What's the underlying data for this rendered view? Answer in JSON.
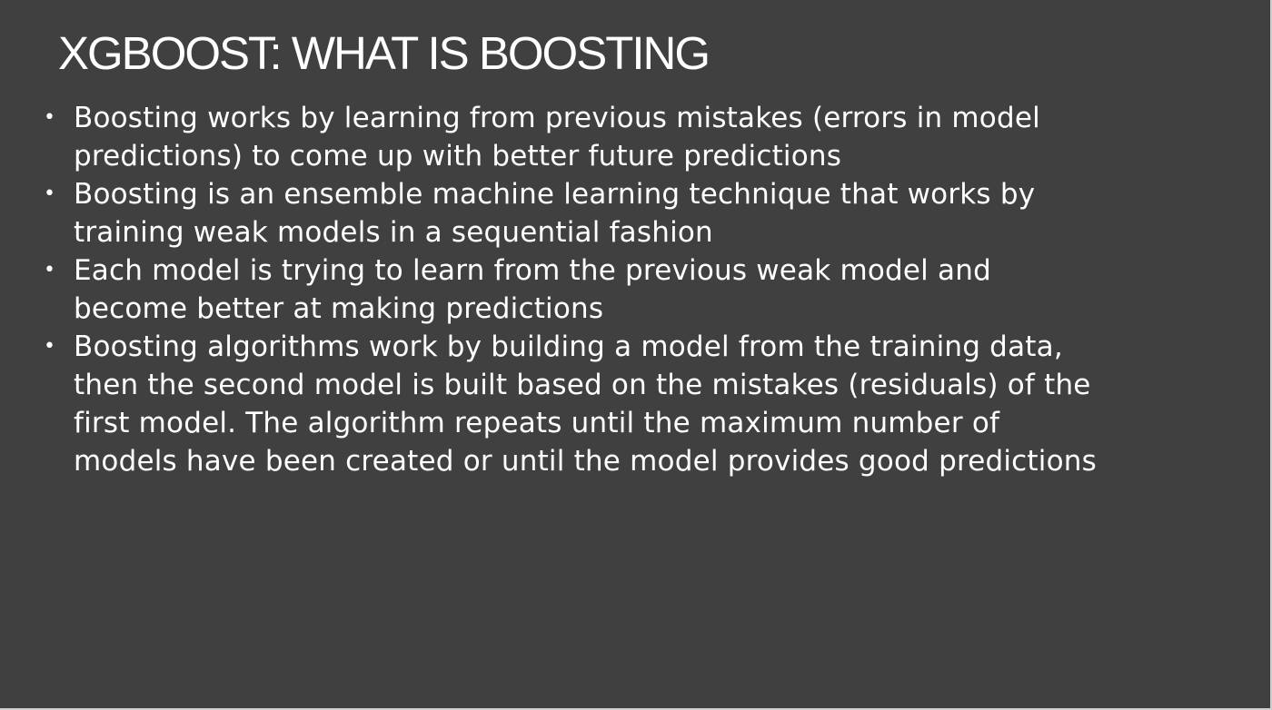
{
  "slide": {
    "title": "XGBOOST: WHAT IS BOOSTING",
    "bullet_glyph": "•",
    "bullets": [
      {
        "lines": [
          "Boosting works by learning from previous mistakes (errors in model",
          "predictions) to come up with better future predictions"
        ]
      },
      {
        "lines": [
          "Boosting is an ensemble machine learning technique that works by",
          "training weak models in a sequential fashion"
        ]
      },
      {
        "lines": [
          "Each model is trying to learn from the previous weak model and",
          "become better at making predictions"
        ]
      },
      {
        "lines": [
          "Boosting algorithms work by building a model from the training data,",
          "then the second model is built based on the mistakes (residuals) of the",
          "first model. The algorithm repeats until the maximum number of",
          "models have been created or until the model provides good predictions"
        ]
      }
    ]
  },
  "colors": {
    "background": "#404040",
    "text": "#ffffff"
  }
}
